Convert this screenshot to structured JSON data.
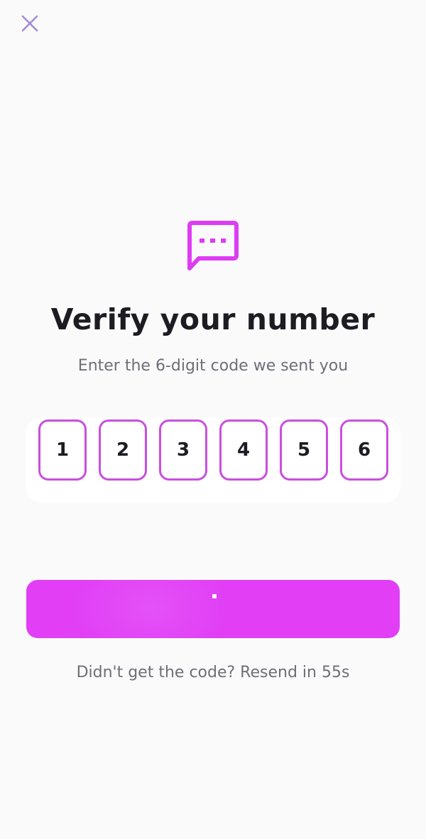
{
  "header": {
    "close_icon": "close-icon"
  },
  "hero": {
    "icon": "message-dots-icon",
    "accent_color": "#dd3cf2",
    "title": "Verify your number",
    "subtitle": "Enter the 6-digit code we sent you"
  },
  "code": {
    "digits": [
      "1",
      "2",
      "3",
      "4",
      "5",
      "6"
    ],
    "border_color": "#c94fdd"
  },
  "submit": {
    "state": "loading",
    "color": "#e13ef6"
  },
  "resend": {
    "text": "Didn't get the code? Resend in 55s"
  }
}
